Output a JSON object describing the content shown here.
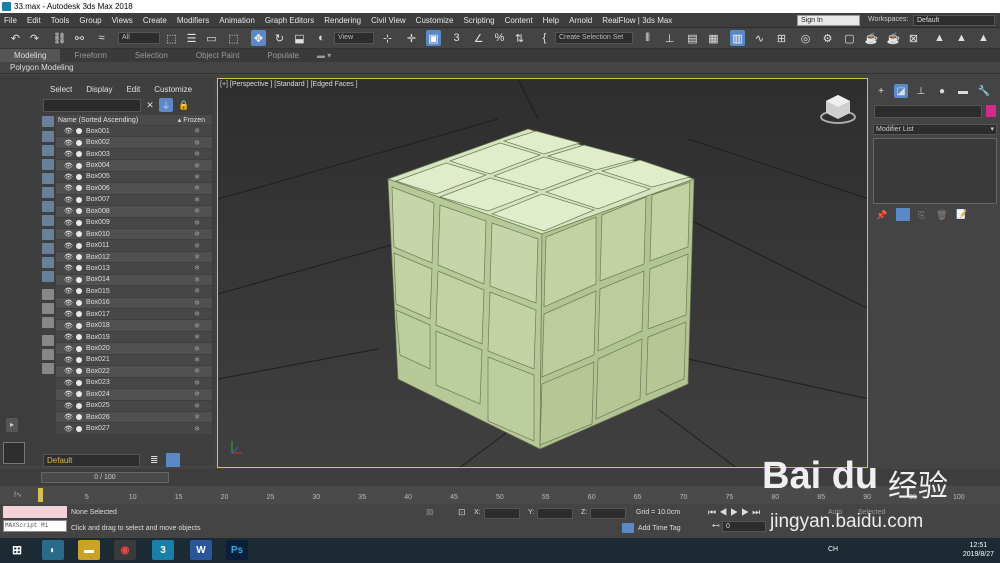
{
  "window": {
    "title": "33.max - Autodesk 3ds Max 2018"
  },
  "menu": [
    "File",
    "Edit",
    "Tools",
    "Group",
    "Views",
    "Create",
    "Modifiers",
    "Animation",
    "Graph Editors",
    "Rendering",
    "Civil View",
    "Customize",
    "Scripting",
    "Content",
    "Help",
    "Arnold",
    "RealFlow | 3ds Max"
  ],
  "account": {
    "signin": "Sign In",
    "workspaces_label": "Workspaces:",
    "workspace": "Default"
  },
  "toolbar": {
    "selection_filter": "All",
    "ref_coord": "View",
    "named_set": "Create Selection Set"
  },
  "ribbon": {
    "tabs": [
      "Modeling",
      "Freeform",
      "Selection",
      "Object Paint",
      "Populate"
    ],
    "active": "Modeling",
    "sub": "Polygon Modeling"
  },
  "explorer": {
    "menu": [
      "Select",
      "Display",
      "Edit",
      "Customize"
    ],
    "col_name": "Name (Sorted Ascending)",
    "col_frozen": "▴ Frozen",
    "rows": [
      "Box001",
      "Box002",
      "Box003",
      "Box004",
      "Box005",
      "Box006",
      "Box007",
      "Box008",
      "Box009",
      "Box010",
      "Box011",
      "Box012",
      "Box013",
      "Box014",
      "Box015",
      "Box016",
      "Box017",
      "Box018",
      "Box019",
      "Box020",
      "Box021",
      "Box022",
      "Box023",
      "Box024",
      "Box025",
      "Box026",
      "Box027"
    ],
    "layer": "Default"
  },
  "viewport": {
    "label": "[+] [Perspective ] [Standard ] [Edged Faces ]"
  },
  "command_panel": {
    "modifier_list": "Modifier List",
    "object_color": "#d42a8c"
  },
  "timeline": {
    "slider": "0 / 100",
    "ticks": [
      "0",
      "5",
      "10",
      "15",
      "20",
      "25",
      "30",
      "35",
      "40",
      "45",
      "50",
      "55",
      "60",
      "65",
      "70",
      "75",
      "80",
      "85",
      "90",
      "95",
      "100"
    ]
  },
  "status": {
    "maxscript": "MAXScript Mi",
    "selection": "None Selected",
    "prompt": "Click and drag to select and move objects",
    "x_label": "X:",
    "y_label": "Y:",
    "z_label": "Z:",
    "grid": "Grid = 10.0cm",
    "add_time_tag": "Add Time Tag",
    "auto": "Auto",
    "selected": "Selected",
    "frame": "0"
  },
  "taskbar": {
    "time": "12:51",
    "date": "2019/8/27",
    "lang": "CH"
  },
  "watermark": {
    "brand": "Bai du",
    "cn": "经验",
    "url": "jingyan.baidu.com"
  }
}
